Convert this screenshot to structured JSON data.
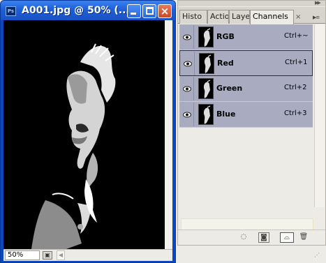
{
  "document": {
    "title": "A001.jpg @ 50% (...",
    "app_icon": "Ps",
    "zoom": "50%",
    "buttons": {
      "minimize": "minimize-icon",
      "maximize": "maximize-icon",
      "close": "×"
    }
  },
  "panel": {
    "tabs": [
      {
        "label": "Histo"
      },
      {
        "label": "Actio"
      },
      {
        "label": "Layer"
      },
      {
        "label": "Channels"
      }
    ],
    "active_tab": "Channels",
    "tab_close": "×",
    "channels": [
      {
        "name": "RGB",
        "shortcut": "Ctrl+~",
        "visible": true,
        "selected": false
      },
      {
        "name": "Red",
        "shortcut": "Ctrl+1",
        "visible": true,
        "selected": true
      },
      {
        "name": "Green",
        "shortcut": "Ctrl+2",
        "visible": true,
        "selected": false
      },
      {
        "name": "Blue",
        "shortcut": "Ctrl+3",
        "visible": true,
        "selected": false
      }
    ],
    "bottom_buttons": [
      "load-selection-icon",
      "save-selection-icon",
      "new-channel-icon",
      "trash-icon"
    ]
  },
  "colors": {
    "titlebar": "#1f5fd8",
    "selected_row": "#a9abc0",
    "close_button": "#c94a26"
  }
}
